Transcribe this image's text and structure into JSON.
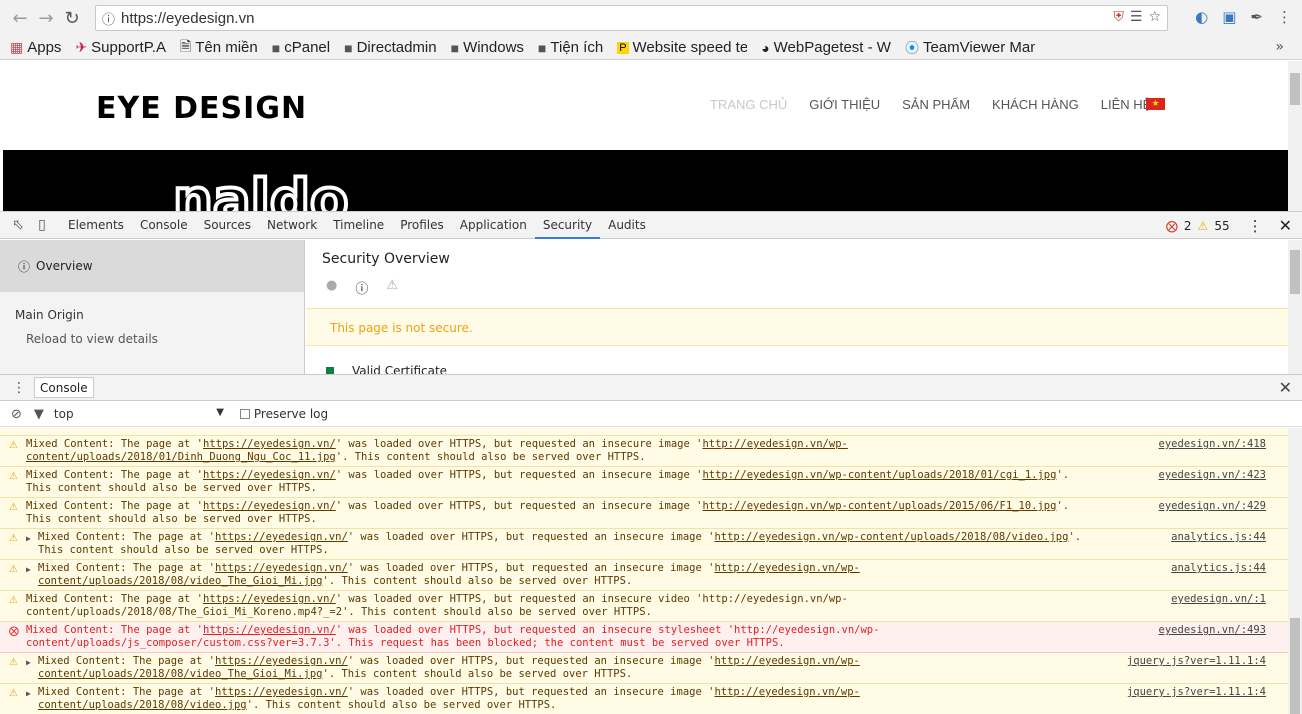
{
  "browser": {
    "url": "https://eyedesign.vn",
    "bookmarks": [
      {
        "label": "Apps",
        "icon": "apps-icon"
      },
      {
        "label": "SupportP.A",
        "icon": "plane-icon"
      },
      {
        "label": "Tên miền",
        "icon": "page-icon"
      },
      {
        "label": "cPanel",
        "icon": "folder-icon"
      },
      {
        "label": "Directadmin",
        "icon": "folder-icon"
      },
      {
        "label": "Windows",
        "icon": "folder-icon"
      },
      {
        "label": "Tiện ích",
        "icon": "folder-icon"
      },
      {
        "label": "Website speed te",
        "icon": "speed-icon"
      },
      {
        "label": "WebPagetest - W",
        "icon": "gauge-icon"
      },
      {
        "label": "TeamViewer Man",
        "icon": "teamviewer-icon"
      }
    ],
    "more": "»"
  },
  "site": {
    "logo": "EYE DESIGN",
    "nav": [
      "TRANG CHỦ",
      "GIỚI THIỆU",
      "SẢN PHẨM",
      "KHÁCH HÀNG",
      "LIÊN HỆ"
    ],
    "banner_text": "naldo"
  },
  "devtools": {
    "tabs": [
      "Elements",
      "Console",
      "Sources",
      "Network",
      "Timeline",
      "Profiles",
      "Application",
      "Security",
      "Audits"
    ],
    "active_tab": "Security",
    "error_count": "2",
    "warning_count": "55",
    "security": {
      "sidebar_overview": "Overview",
      "main_origin": "Main Origin",
      "reload_hint": "Reload to view details",
      "title": "Security Overview",
      "alert": "This page is not secure.",
      "valid_cert": "Valid Certificate"
    },
    "drawer": {
      "tab": "Console",
      "context": "top",
      "preserve_log": "Preserve log"
    },
    "messages": [
      {
        "level": "warn",
        "expand": false,
        "l1a": "Mixed Content: The page at '",
        "l1u": "https://eyedesign.vn/",
        "l1b": "' was loaded over HTTPS, but requested an insecure image '",
        "l1u2": "http://eyedesign.vn/wp-",
        "l2u": "content/uploads/2018/01/Dinh_Duong_Ngu_Coc_11.jpg",
        "l2b": "'. This content should also be served over HTTPS.",
        "src": "eyedesign.vn/:418"
      },
      {
        "level": "warn",
        "expand": false,
        "l1a": "Mixed Content: The page at '",
        "l1u": "https://eyedesign.vn/",
        "l1b": "' was loaded over HTTPS, but requested an insecure image '",
        "l1u2": "http://eyedesign.vn/wp-content/uploads/2018/01/cgi_1.jpg",
        "l1c": "'.",
        "l2u": "",
        "l2b": "This content should also be served over HTTPS.",
        "src": "eyedesign.vn/:423"
      },
      {
        "level": "warn",
        "expand": false,
        "l1a": "Mixed Content: The page at '",
        "l1u": "https://eyedesign.vn/",
        "l1b": "' was loaded over HTTPS, but requested an insecure image '",
        "l1u2": "http://eyedesign.vn/wp-content/uploads/2015/06/F1_10.jpg",
        "l1c": "'.",
        "l2u": "",
        "l2b": "This content should also be served over HTTPS.",
        "src": "eyedesign.vn/:429"
      },
      {
        "level": "warn",
        "expand": true,
        "l1a": "Mixed Content: The page at '",
        "l1u": "https://eyedesign.vn/",
        "l1b": "' was loaded over HTTPS, but requested an insecure image '",
        "l1u2": "http://eyedesign.vn/wp-content/uploads/2018/08/video.jpg",
        "l1c": "'.",
        "l2u": "",
        "l2b": "This content should also be served over HTTPS.",
        "src": "analytics.js:44"
      },
      {
        "level": "warn",
        "expand": true,
        "l1a": "Mixed Content: The page at '",
        "l1u": "https://eyedesign.vn/",
        "l1b": "' was loaded over HTTPS, but requested an insecure image '",
        "l1u2": "http://eyedesign.vn/wp-",
        "l2u": "content/uploads/2018/08/video_The_Gioi_Mi.jpg",
        "l2b": "'. This content should also be served over HTTPS.",
        "src": "analytics.js:44"
      },
      {
        "level": "warn",
        "expand": false,
        "l1a": "Mixed Content: The page at '",
        "l1u": "https://eyedesign.vn/",
        "l1b": "' was loaded over HTTPS, but requested an insecure video 'http://eyedesign.vn/wp-",
        "l1u2": "",
        "l2u": "",
        "l2b": "content/uploads/2018/08/The_Gioi_Mi_Koreno.mp4?_=2'. This content should also be served over HTTPS.",
        "src": "eyedesign.vn/:1"
      },
      {
        "level": "error",
        "expand": false,
        "l1a": "Mixed Content: The page at '",
        "l1u": "https://eyedesign.vn/",
        "l1b": "' was loaded over HTTPS, but requested an insecure stylesheet 'http://eyedesign.vn/wp-",
        "l1u2": "",
        "l2u": "",
        "l2b": "content/uploads/js_composer/custom.css?ver=3.7.3'. This request has been blocked; the content must be served over HTTPS.",
        "src": "eyedesign.vn/:493"
      },
      {
        "level": "warn",
        "expand": true,
        "l1a": "Mixed Content: The page at '",
        "l1u": "https://eyedesign.vn/",
        "l1b": "' was loaded over HTTPS, but requested an insecure image '",
        "l1u2": "http://eyedesign.vn/wp-",
        "l2u": "content/uploads/2018/08/video_The_Gioi_Mi.jpg",
        "l2b": "'. This content should also be served over HTTPS.",
        "src": "jquery.js?ver=1.11.1:4"
      },
      {
        "level": "warn",
        "expand": true,
        "l1a": "Mixed Content: The page at '",
        "l1u": "https://eyedesign.vn/",
        "l1b": "' was loaded over HTTPS, but requested an insecure image '",
        "l1u2": "http://eyedesign.vn/wp-",
        "l2u": "content/uploads/2018/08/video.jpg",
        "l2b": "'. This content should also be served over HTTPS.",
        "src": "jquery.js?ver=1.11.1:4"
      }
    ]
  }
}
